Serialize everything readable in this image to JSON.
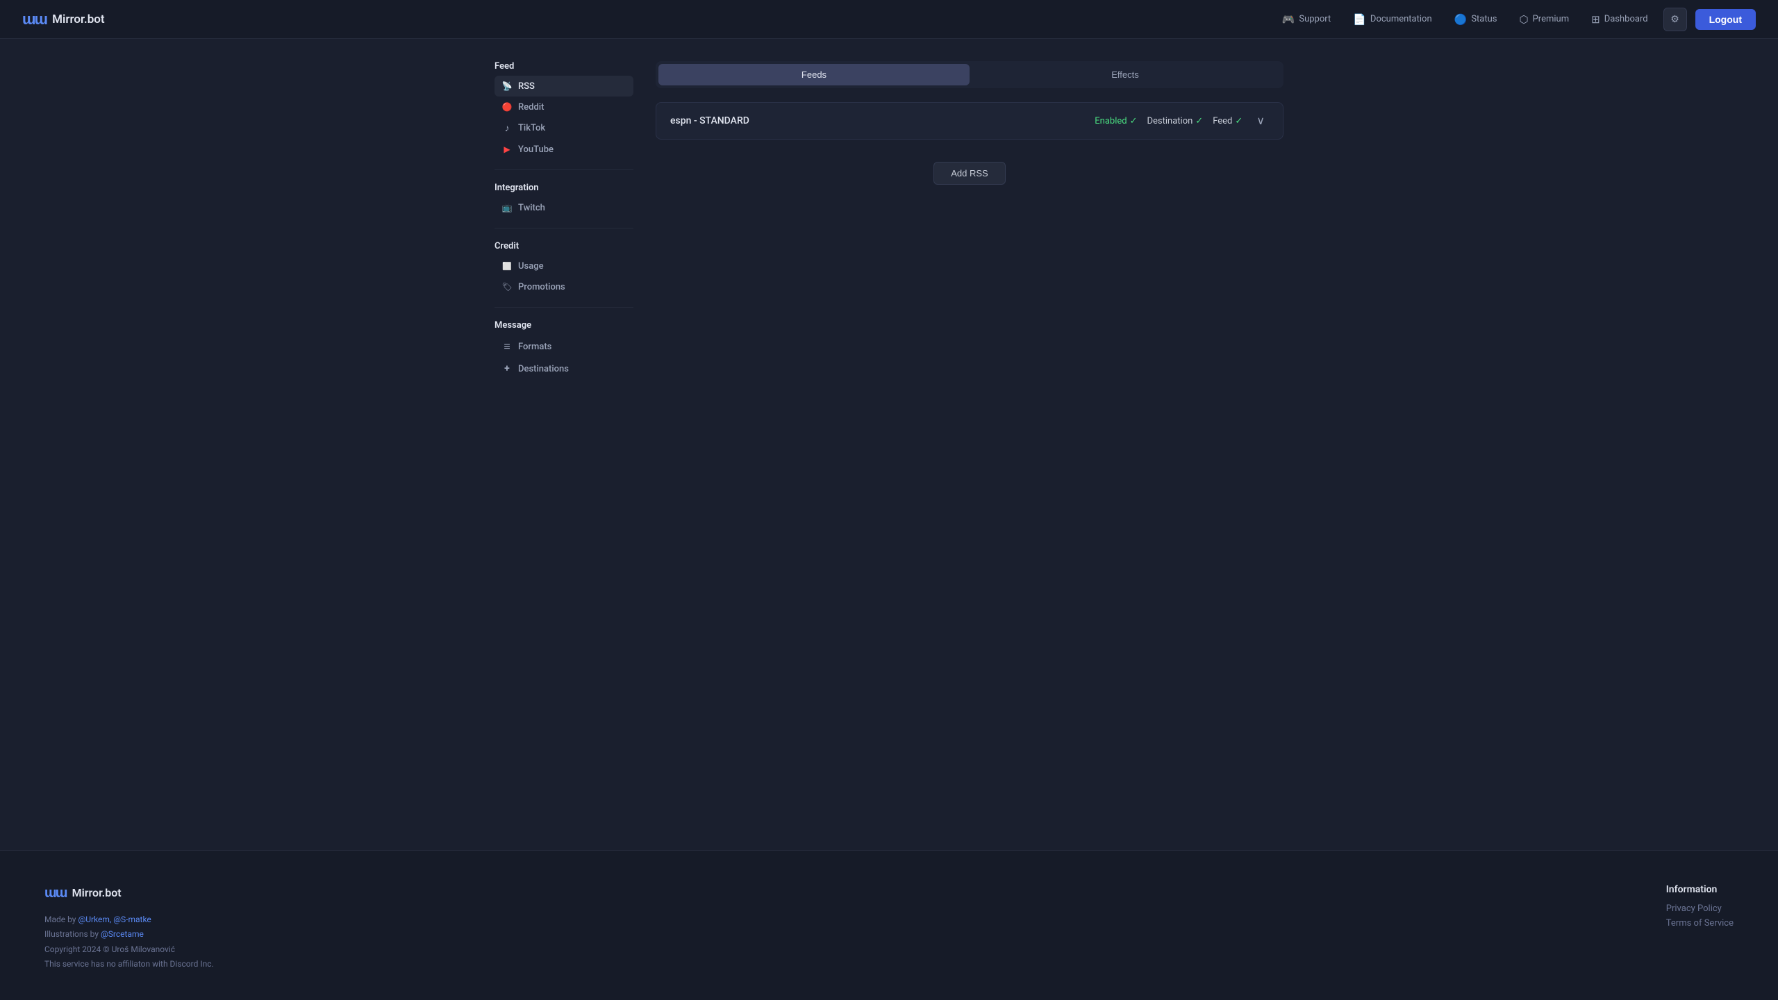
{
  "app": {
    "name": "Mirror.bot"
  },
  "topnav": {
    "support_label": "Support",
    "documentation_label": "Documentation",
    "status_label": "Status",
    "premium_label": "Premium",
    "dashboard_label": "Dashboard",
    "logout_label": "Logout"
  },
  "sidebar": {
    "feed_section_label": "Feed",
    "integration_section_label": "Integration",
    "credit_section_label": "Credit",
    "message_section_label": "Message",
    "feed_items": [
      {
        "label": "RSS",
        "icon": "rss"
      },
      {
        "label": "Reddit",
        "icon": "reddit"
      },
      {
        "label": "TikTok",
        "icon": "tiktok"
      },
      {
        "label": "YouTube",
        "icon": "youtube"
      }
    ],
    "integration_items": [
      {
        "label": "Twitch",
        "icon": "twitch"
      }
    ],
    "credit_items": [
      {
        "label": "Usage",
        "icon": "usage"
      },
      {
        "label": "Promotions",
        "icon": "promotions"
      }
    ],
    "message_items": [
      {
        "label": "Formats",
        "icon": "formats"
      },
      {
        "label": "Destinations",
        "icon": "destinations"
      }
    ]
  },
  "content": {
    "tabs": [
      {
        "label": "Feeds"
      },
      {
        "label": "Effects"
      }
    ],
    "active_tab": 0,
    "feed_item": {
      "name": "espn - STANDARD",
      "enabled_label": "Enabled",
      "destination_label": "Destination",
      "feed_label": "Feed",
      "check": "✓"
    },
    "add_rss_label": "Add RSS"
  },
  "footer": {
    "logo_text": "Mirror.bot",
    "made_by_prefix": "Made by ",
    "made_by_users": "@Urkem, @S-matke",
    "illustrations_prefix": "Illustrations by ",
    "illustrations_user": "@Srcetame",
    "copyright": "Copyright 2024 © Uroš Milovanović",
    "disclaimer": "This service has no affiliaton with Discord Inc.",
    "information_title": "Information",
    "privacy_policy_label": "Privacy Policy",
    "terms_label": "Terms of Service"
  }
}
